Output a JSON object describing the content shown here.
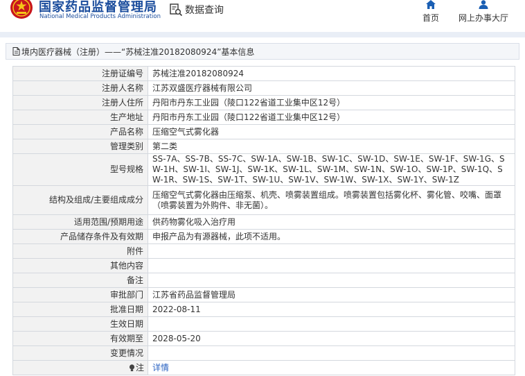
{
  "header": {
    "logo_cn": "国家药品监督管理局",
    "logo_en": "National Medical Products Administration",
    "query_label": "数据查询",
    "nav": [
      {
        "label": "首页",
        "icon": "home-icon"
      },
      {
        "label": "网上办事大厅",
        "icon": "user-icon"
      }
    ]
  },
  "breadcrumb": {
    "text": "境内医疗器械（注册）——“苏械注准20182080924”基本信息",
    "icon": "document-icon"
  },
  "details": [
    {
      "label": "注册证编号",
      "value": "苏械注准20182080924"
    },
    {
      "label": "注册人名称",
      "value": "江苏双盛医疗器械有限公司"
    },
    {
      "label": "注册人住所",
      "value": "丹阳市丹东工业园（陵口122省道工业集中区12号）"
    },
    {
      "label": "生产地址",
      "value": "丹阳市丹东工业园（陵口122省道工业集中区12号）"
    },
    {
      "label": "产品名称",
      "value": "压缩空气式雾化器"
    },
    {
      "label": "管理类别",
      "value": "第二类"
    },
    {
      "label": "型号规格",
      "value": "SS-7A、SS-7B、SS-7C、SW-1A、SW-1B、SW-1C、SW-1D、SW-1E、SW-1F、SW-1G、SW-1H、SW-1I、SW-1J、SW-1K、SW-1L、SW-1M、SW-1N、SW-1O、SW-1P、SW-1Q、SW-1R、SW-1S、SW-1T、SW-1U、SW-1V、SW-1W、SW-1X、SW-1Y、SW-1Z"
    },
    {
      "label": "结构及组成/主要组成成分",
      "value": "压缩空气式雾化器由压缩泵、机壳、喷雾装置组成。喷雾装置包括雾化杯、雾化管、咬嘴、面罩（喷雾装置为外购件、非无菌）。"
    },
    {
      "label": "适用范围/预期用途",
      "value": "供药物雾化吸入治疗用"
    },
    {
      "label": "产品储存条件及有效期",
      "value": "申报产品为有源器械，此项不适用。"
    },
    {
      "label": "附件",
      "value": ""
    },
    {
      "label": "其他内容",
      "value": ""
    },
    {
      "label": "备注",
      "value": ""
    },
    {
      "label": "审批部门",
      "value": "江苏省药品监督管理局"
    },
    {
      "label": "批准日期",
      "value": "2022-08-11"
    },
    {
      "label": "生效日期",
      "value": ""
    },
    {
      "label": "有效期至",
      "value": "2028-05-20"
    },
    {
      "label": "变更情况",
      "value": ""
    }
  ],
  "note": {
    "label": "注",
    "link": "详情",
    "icon": "lightbulb-icon"
  }
}
